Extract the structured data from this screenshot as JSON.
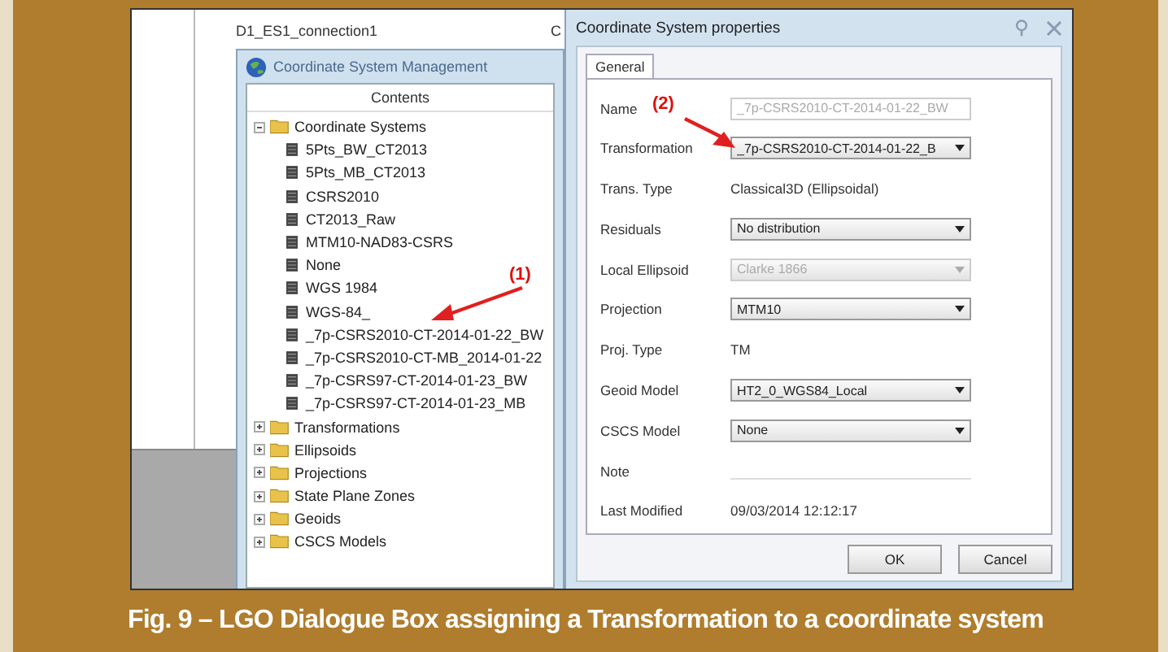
{
  "background_window": {
    "title": "D1_ES1_connection1",
    "title_cut": "C"
  },
  "management_window": {
    "title": "Coordinate System Management",
    "column_header": "Contents",
    "tree": [
      {
        "label": "Coordinate Systems",
        "expanded": true,
        "children": [
          {
            "label": "5Pts_BW_CT2013"
          },
          {
            "label": "5Pts_MB_CT2013"
          },
          {
            "label": "CSRS2010"
          },
          {
            "label": "CT2013_Raw"
          },
          {
            "label": "MTM10-NAD83-CSRS"
          },
          {
            "label": "None"
          },
          {
            "label": "WGS 1984"
          },
          {
            "label": "WGS-84_"
          },
          {
            "label": "_7p-CSRS2010-CT-2014-01-22_BW"
          },
          {
            "label": "_7p-CSRS2010-CT-MB_2014-01-22"
          },
          {
            "label": "_7p-CSRS97-CT-2014-01-23_BW"
          },
          {
            "label": "_7p-CSRS97-CT-2014-01-23_MB"
          }
        ]
      },
      {
        "label": "Transformations",
        "expanded": false
      },
      {
        "label": "Ellipsoids",
        "expanded": false
      },
      {
        "label": "Projections",
        "expanded": false
      },
      {
        "label": "State Plane Zones",
        "expanded": false
      },
      {
        "label": "Geoids",
        "expanded": false
      },
      {
        "label": "CSCS Models",
        "expanded": false
      }
    ]
  },
  "properties_dialog": {
    "title": "Coordinate System properties",
    "tabs": [
      {
        "label": "General",
        "selected": true
      }
    ],
    "fields": [
      {
        "kind": "input",
        "label": "Name",
        "value": "_7p-CSRS2010-CT-2014-01-22_BW",
        "disabled": true
      },
      {
        "kind": "dropdown",
        "label": "Transformation",
        "value": "_7p-CSRS2010-CT-2014-01-22_B",
        "disabled": false
      },
      {
        "kind": "text",
        "label": "Trans. Type",
        "value": "Classical3D (Ellipsoidal)"
      },
      {
        "kind": "dropdown",
        "label": "Residuals",
        "value": "No distribution",
        "disabled": false
      },
      {
        "kind": "dropdown",
        "label": "Local Ellipsoid",
        "value": "Clarke 1866",
        "disabled": true
      },
      {
        "kind": "dropdown",
        "label": "Projection",
        "value": "MTM10",
        "disabled": false
      },
      {
        "kind": "text",
        "label": "Proj. Type",
        "value": "TM"
      },
      {
        "kind": "dropdown",
        "label": "Geoid Model",
        "value": "HT2_0_WGS84_Local",
        "disabled": false
      },
      {
        "kind": "dropdown",
        "label": "CSCS Model",
        "value": "None",
        "disabled": false
      },
      {
        "kind": "memo",
        "label": "Note"
      },
      {
        "kind": "text",
        "label": "Last Modified",
        "value": "09/03/2014 12:12:17"
      }
    ],
    "buttons": [
      "OK",
      "Cancel"
    ]
  },
  "annotations": [
    {
      "label": "(1)"
    },
    {
      "label": "(2)"
    }
  ],
  "caption": "Fig. 9 – LGO Dialogue Box assigning a Transformation to a coordinate system"
}
